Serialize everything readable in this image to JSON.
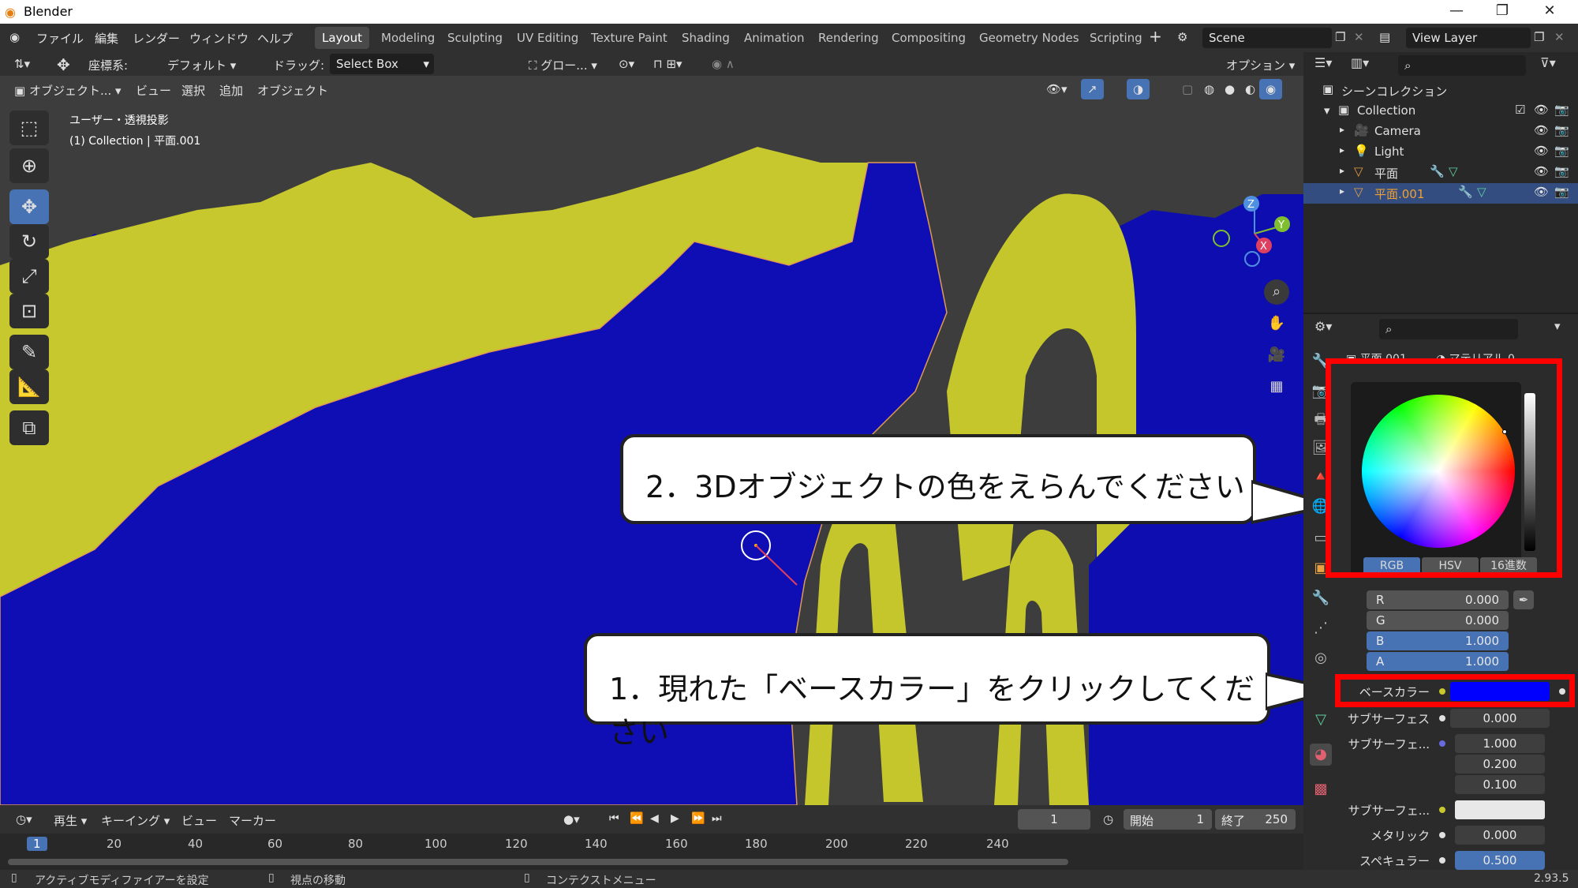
{
  "app": {
    "title": "Blender",
    "version": "2.93.5"
  },
  "menu": [
    "ファイル",
    "編集",
    "レンダー",
    "ウィンドウ",
    "ヘルプ"
  ],
  "workspaces": [
    "Layout",
    "Modeling",
    "Sculpting",
    "UV Editing",
    "Texture Paint",
    "Shading",
    "Animation",
    "Rendering",
    "Compositing",
    "Geometry Nodes",
    "Scripting"
  ],
  "active_workspace": "Layout",
  "scene": "Scene",
  "view_layer": "View Layer",
  "viewport_header": {
    "coord_label": "座標系:",
    "coord_value": "デフォルト",
    "drag_label": "ドラッグ:",
    "drag_value": "Select Box",
    "transform_pivot": "グロー...",
    "options": "オプション"
  },
  "viewport_menu": {
    "mode": "オブジェクト...",
    "view": "ビュー",
    "select": "選択",
    "add": "追加",
    "object": "オブジェクト"
  },
  "viewport_info": {
    "line1": "ユーザー・透視投影",
    "line2": "(1) Collection | 平面.001"
  },
  "callouts": {
    "step1": "1．現れた「ベースカラー」をクリックしてください",
    "step2": "2．3Dオブジェクトの色をえらんでください"
  },
  "outliner": {
    "root": "シーンコレクション",
    "collection": "Collection",
    "items": [
      "Camera",
      "Light",
      "平面",
      "平面.001"
    ]
  },
  "properties": {
    "object": "平面.001",
    "material": "マテリアル.0",
    "picker_tabs": [
      "RGB",
      "HSV",
      "16進数"
    ],
    "rgba": [
      {
        "label": "R",
        "value": "0.000"
      },
      {
        "label": "G",
        "value": "0.000"
      },
      {
        "label": "B",
        "value": "1.000"
      },
      {
        "label": "A",
        "value": "1.000"
      }
    ],
    "base_color_label": "ベースカラー",
    "base_color": "#0000ff",
    "rows": [
      {
        "label": "サブサーフェス",
        "value": "0.000"
      },
      {
        "label": "サブサーフェ...",
        "value": "1.000"
      },
      {
        "label": "",
        "value": "0.200"
      },
      {
        "label": "",
        "value": "0.100"
      },
      {
        "label": "サブサーフェ...",
        "value": ""
      },
      {
        "label": "メタリック",
        "value": "0.000"
      },
      {
        "label": "スペキュラー",
        "value": "0.500"
      }
    ]
  },
  "timeline": {
    "play": "再生",
    "keying": "キーイング",
    "view": "ビュー",
    "marker": "マーカー",
    "current_frame": "1",
    "start_label": "開始",
    "start": "1",
    "end_label": "終了",
    "end": "250",
    "ticks": [
      "1",
      "20",
      "40",
      "60",
      "80",
      "100",
      "120",
      "140",
      "160",
      "180",
      "200",
      "220",
      "240"
    ]
  },
  "status": {
    "left": "アクティブモディファイアーを設定",
    "mid": "視点の移動",
    "right": "コンテクストメニュー"
  },
  "colors": {
    "blue": "#0e0eb4",
    "yellow": "#c7c72e",
    "accent": "#4772b3",
    "highlight": "#ff0000"
  }
}
